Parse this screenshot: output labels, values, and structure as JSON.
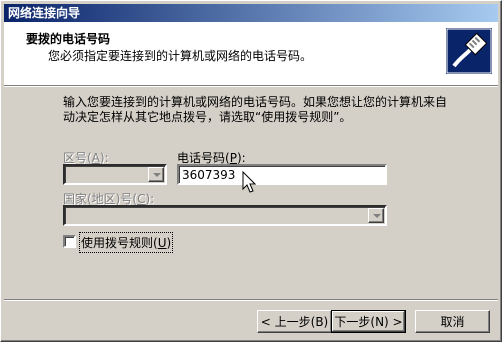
{
  "window": {
    "title": "网络连接向导"
  },
  "header": {
    "title": "要拨的电话号码",
    "subtitle": "您必须指定要连接到的计算机或网络的电话号码。",
    "icon": "phone-cable-plug-icon"
  },
  "intro": {
    "text": "输入您要连接到的计算机或网络的电话号码。如果您想让您的计算机来自动决定怎样从其它地点拨号，请选取“使用拨号规则”。"
  },
  "fields": {
    "area_code": {
      "label": "区号",
      "accel": "A",
      "value": "",
      "enabled": false
    },
    "phone_number": {
      "label": "电话号码",
      "accel": "P",
      "value": "3607393"
    },
    "country": {
      "label": "国家(地区)号",
      "accel": "C",
      "value": "",
      "enabled": false
    }
  },
  "dialing_rules": {
    "label": "使用拨号规则",
    "accel": "U",
    "checked": false
  },
  "buttons": {
    "back": {
      "label": "< 上一步(B)"
    },
    "next": {
      "label": "下一步(N) >"
    },
    "cancel": {
      "label": "取消"
    }
  },
  "colors": {
    "titlebar_start": "#0a246a",
    "titlebar_end": "#a6caf0",
    "face": "#d4d0c8"
  }
}
